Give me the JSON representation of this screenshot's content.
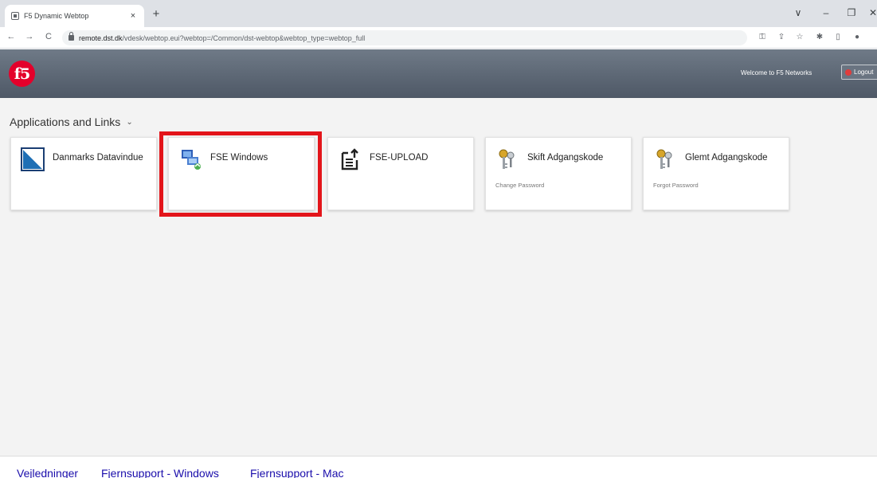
{
  "browser": {
    "tab_title": "F5 Dynamic Webtop",
    "tab_close": "×",
    "new_tab": "+",
    "url_host": "remote.dst.dk",
    "url_path": "/vdesk/webtop.eui?webtop=/Common/dst-webtop&webtop_type=webtop_full",
    "window_controls": [
      "∨",
      "–",
      "❐",
      "✕"
    ],
    "nav": {
      "back": "←",
      "forward": "→",
      "reload": "C"
    },
    "toolbar_icons": [
      "key-icon",
      "share-icon",
      "star-icon",
      "extensions-icon",
      "sidepanel-icon",
      "profile-icon"
    ]
  },
  "header": {
    "logo_text": "f5",
    "welcome": "Welcome to F5 Networks",
    "logout_label": "Logout",
    "brand_color": "#e4002b"
  },
  "section": {
    "title": "Applications and Links",
    "chevron": "⌄"
  },
  "tiles": [
    {
      "title": "Danmarks Datavindue",
      "subtitle": "",
      "icon": "datavindue-icon"
    },
    {
      "title": "FSE Windows",
      "subtitle": "",
      "icon": "remote-desktop-icon"
    },
    {
      "title": "FSE-UPLOAD",
      "subtitle": "",
      "icon": "upload-icon"
    },
    {
      "title": "Skift Adgangskode",
      "subtitle": "Change Password",
      "icon": "keys-icon"
    },
    {
      "title": "Glemt Adgangskode",
      "subtitle": "Forgot Password",
      "icon": "keys-icon"
    }
  ],
  "highlight_color": "#e3151b",
  "footer": {
    "links": [
      "Vejledninger",
      "Fjernsupport - Windows",
      "Fjernsupport - Mac"
    ]
  }
}
